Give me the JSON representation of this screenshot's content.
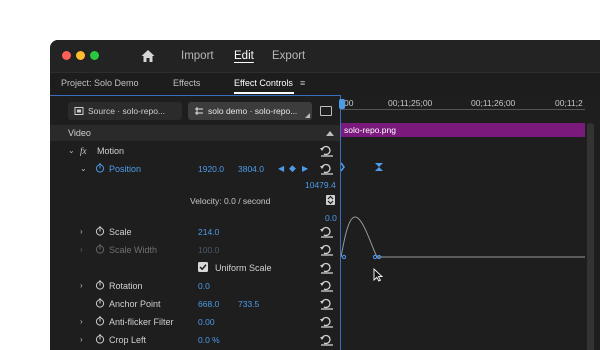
{
  "window": {
    "nav": [
      "Import",
      "Edit",
      "Export"
    ],
    "active_nav": "Edit"
  },
  "projbar": {
    "project": "Project: Solo Demo",
    "effects": "Effects",
    "effect_controls": "Effect Controls",
    "menu_icon": "≡"
  },
  "tabs": {
    "source": "Source · solo-repo...",
    "sequence": "solo demo · solo-repo..."
  },
  "controls": {
    "video_label": "Video",
    "motion": "Motion",
    "position": {
      "label": "Position",
      "x": "1920.0",
      "y": "3804.0"
    },
    "graph": {
      "max": "10479.4",
      "min": "0.0",
      "velocity": "Velocity: 0.0 / second"
    },
    "scale": {
      "label": "Scale",
      "value": "214.0"
    },
    "scale_width": {
      "label": "Scale Width",
      "value": "100.0"
    },
    "uniform_scale": "Uniform Scale",
    "rotation": {
      "label": "Rotation",
      "value": "0.0"
    },
    "anchor_point": {
      "label": "Anchor Point",
      "x": "668.0",
      "y": "733.5"
    },
    "anti_flicker": {
      "label": "Anti-flicker Filter",
      "value": "0.00"
    },
    "crop_left": {
      "label": "Crop Left",
      "value": "0.0 %"
    }
  },
  "timeline": {
    "ruler": [
      "00",
      "00;11;25;00",
      "00;11;26;00",
      "00;11;2"
    ],
    "clip": "solo-repo.png"
  },
  "colors": {
    "accent": "#4e9bea",
    "clip": "#7a1a7c"
  },
  "icons": [
    "home-icon",
    "stopwatch-icon",
    "reset-icon",
    "keyframe-icon",
    "fx-icon",
    "checkbox-icon",
    "panel-menu-icon"
  ]
}
